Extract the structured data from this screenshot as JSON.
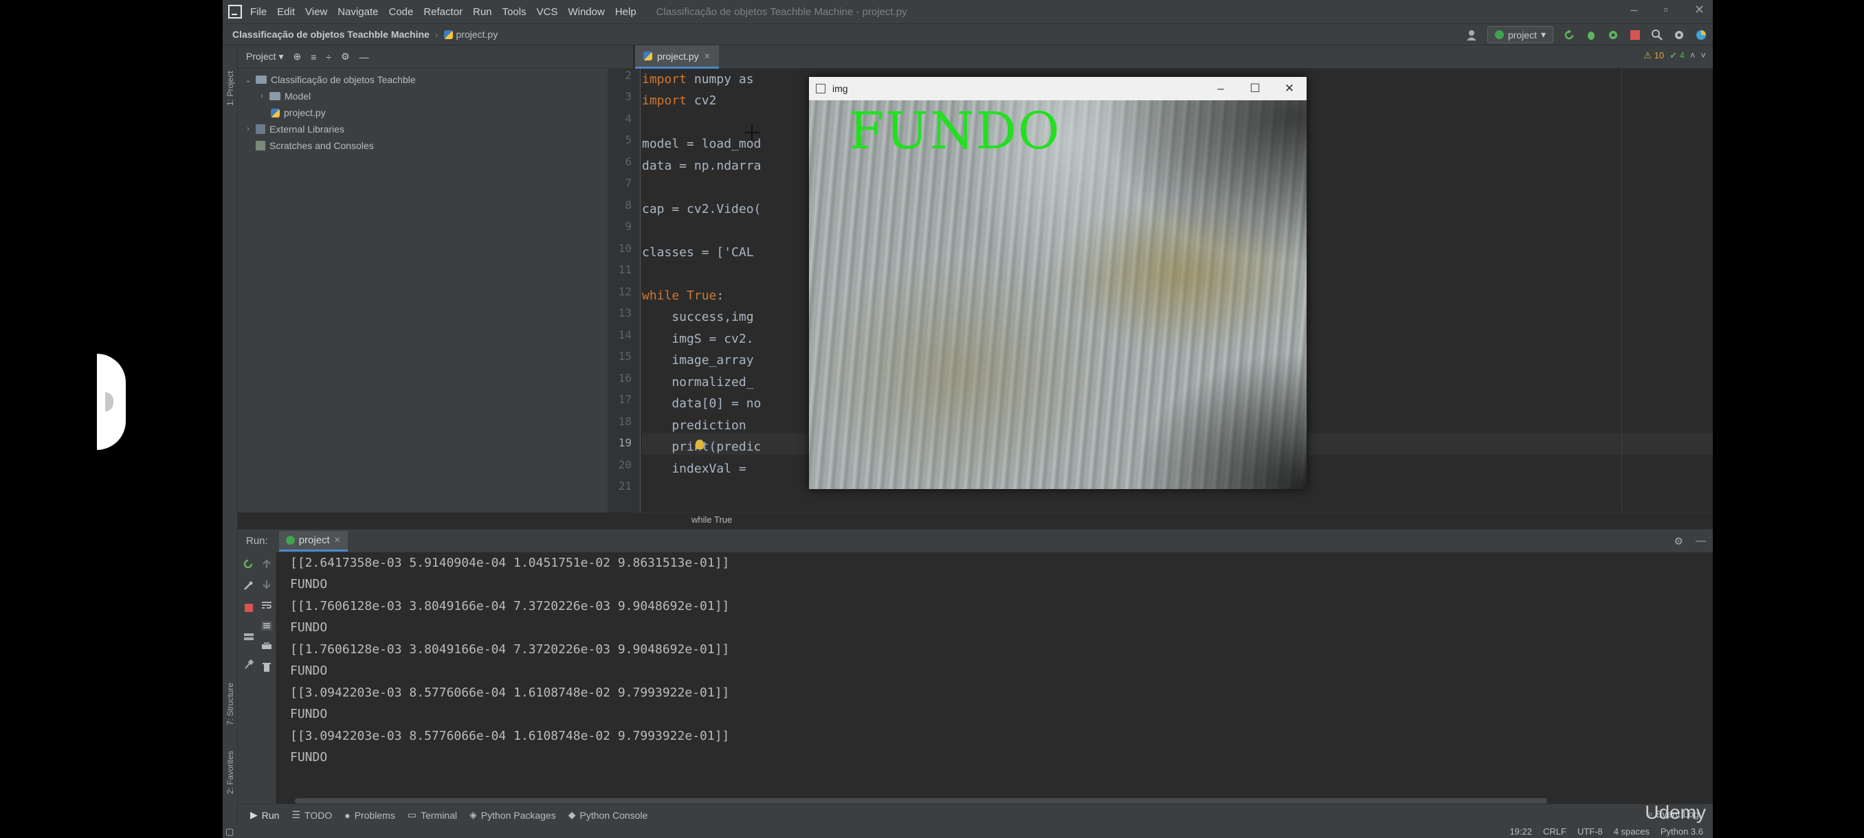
{
  "menu": {
    "items": [
      "File",
      "Edit",
      "View",
      "Navigate",
      "Code",
      "Refactor",
      "Run",
      "Tools",
      "VCS",
      "Window",
      "Help"
    ],
    "window_title": "Classificação de objetos Teachble Machine - project.py"
  },
  "navbar": {
    "project_crumb": "Classificação de objetos Teachble Machine",
    "file_crumb": "project.py",
    "run_config": "project"
  },
  "side_labels": {
    "project": "1: Project",
    "structure": "7: Structure",
    "favorites": "2: Favorites"
  },
  "project_panel": {
    "header": "Project",
    "tree": [
      {
        "label": "Classificação de objetos Teachble",
        "kind": "folder",
        "expanded": true
      },
      {
        "label": "Model",
        "kind": "folder",
        "expanded": false
      },
      {
        "label": "project.py",
        "kind": "python-file"
      },
      {
        "label": "External Libraries",
        "kind": "library",
        "expanded": false
      },
      {
        "label": "Scratches and Consoles",
        "kind": "scratch"
      }
    ]
  },
  "editor": {
    "tab_label": "project.py",
    "inspections": {
      "warnings": "10",
      "ok": "4"
    },
    "line_numbers": [
      "2",
      "3",
      "4",
      "5",
      "6",
      "7",
      "8",
      "9",
      "10",
      "11",
      "12",
      "13",
      "14",
      "15",
      "16",
      "17",
      "18",
      "19",
      "20",
      "21"
    ],
    "current_line": "19",
    "code_lines": [
      {
        "kw": "import",
        "rest": " numpy as"
      },
      {
        "kw": "import",
        "rest": " cv2"
      },
      {
        "kw": "",
        "rest": ""
      },
      {
        "kw": "",
        "rest": "model = load_mod"
      },
      {
        "kw": "",
        "rest": "data = np.ndarra"
      },
      {
        "kw": "",
        "rest": ""
      },
      {
        "kw": "",
        "rest": "cap = cv2.Video("
      },
      {
        "kw": "",
        "rest": ""
      },
      {
        "kw": "",
        "rest": "classes = ['CAL"
      },
      {
        "kw": "",
        "rest": ""
      },
      {
        "kw": "while True",
        "rest": ":"
      },
      {
        "kw": "",
        "rest": "    success,img"
      },
      {
        "kw": "",
        "rest": "    imgS = cv2."
      },
      {
        "kw": "",
        "rest": "    image_array"
      },
      {
        "kw": "",
        "rest": "    normalized_"
      },
      {
        "kw": "",
        "rest": "    data[0] = no"
      },
      {
        "kw": "",
        "rest": "    prediction"
      },
      {
        "kw": "",
        "rest": "    print(predic"
      },
      {
        "kw": "",
        "rest": "    indexVal ="
      },
      {
        "kw": "",
        "rest": ""
      }
    ],
    "breadcrumb": "while True"
  },
  "cv_window": {
    "title": "img",
    "overlay_text": "FUNDO"
  },
  "run_panel": {
    "title": "Run:",
    "tab": "project",
    "output": [
      "[[2.6417358e-03 5.9140904e-04 1.0451751e-02 9.8631513e-01]]",
      "FUNDO",
      "[[1.7606128e-03 3.8049166e-04 7.3720226e-03 9.9048692e-01]]",
      "FUNDO",
      "[[1.7606128e-03 3.8049166e-04 7.3720226e-03 9.9048692e-01]]",
      "FUNDO",
      "[[3.0942203e-03 8.5776066e-04 1.6108748e-02 9.7993922e-01]]",
      "FUNDO",
      "[[3.0942203e-03 8.5776066e-04 1.6108748e-02 9.7993922e-01]]",
      "FUNDO"
    ]
  },
  "tool_tabs": [
    "Run",
    "TODO",
    "Problems",
    "Terminal",
    "Python Packages",
    "Python Console"
  ],
  "event_log": "Event Log",
  "watermark": "Udemy",
  "status": {
    "position": "19:22",
    "line_sep": "CRLF",
    "encoding": "UTF-8",
    "indent": "4 spaces",
    "interpreter": "Python 3.6"
  },
  "colors": {
    "accent": "#4a88c7",
    "overlay_text": "#22e020",
    "keyword": "#cc7832",
    "string": "#6a8759"
  }
}
